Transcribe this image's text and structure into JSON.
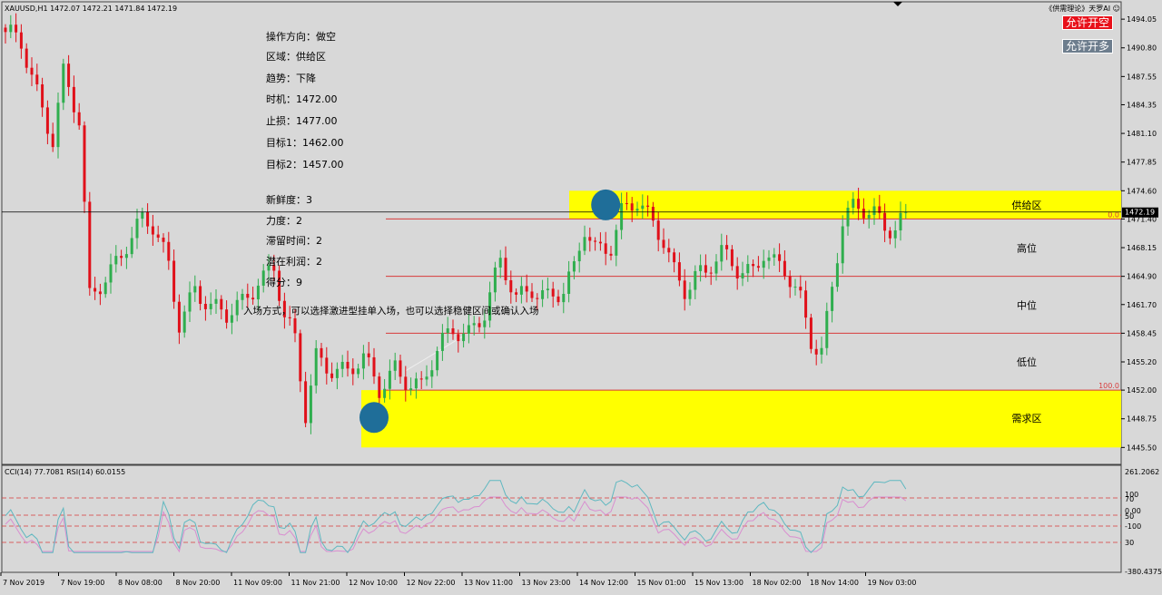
{
  "header": {
    "symbol_line": "XAUUSD,H1  1472.07 1472.21 1471.84 1472.19",
    "brand": "《供需理论》天罗AI ☺"
  },
  "buttons": {
    "sell_label": "允许开空",
    "buy_label": "允许开多"
  },
  "colors": {
    "background": "#d8d8d8",
    "bull": "#2fae4e",
    "bear": "#e0101a",
    "zone": "#ffff00",
    "level_line": "#d83a3a",
    "marker": "#1f6e99",
    "cci": "#5fb8c0",
    "rsi": "#d98ed0"
  },
  "trade_info": {
    "direction": "操作方向：做空",
    "zone": "区域：供给区",
    "trend": "趋势：下降",
    "timing": "时机：1472.00",
    "stop_loss": "止损：1477.00",
    "target1": "目标1：1462.00",
    "target2": "目标2：1457.00",
    "freshness": "新鲜度：3",
    "strength": "力度：2",
    "stay_time": "滞留时间：2",
    "profit_potential": "潜在利润：2",
    "score": "得分：9",
    "entry_note": "入场方式，可以选择激进型挂单入场，也可以选择稳健区间或确认入场"
  },
  "chart_data": [
    {
      "type": "candlestick",
      "symbol": "XAUUSD",
      "timeframe": "H1",
      "ylim": [
        1444.3,
        1495.4
      ],
      "y_ticks": [
        "1494.05",
        "1490.80",
        "1487.55",
        "1484.35",
        "1481.10",
        "1477.85",
        "1474.60",
        "1471.40",
        "1468.15",
        "1464.90",
        "1461.70",
        "1458.45",
        "1455.20",
        "1452.00",
        "1448.75",
        "1445.50"
      ],
      "current_price": "1472.19",
      "x_ticks": [
        "7 Nov 2019",
        "7 Nov 19:00",
        "8 Nov 08:00",
        "8 Nov 20:00",
        "11 Nov 09:00",
        "11 Nov 21:00",
        "12 Nov 10:00",
        "12 Nov 22:00",
        "13 Nov 11:00",
        "13 Nov 23:00",
        "14 Nov 12:00",
        "15 Nov 01:00",
        "15 Nov 13:00",
        "18 Nov 02:00",
        "18 Nov 14:00",
        "19 Nov 03:00"
      ],
      "waypoints": [
        [
          0,
          1492
        ],
        [
          3,
          1491
        ],
        [
          6,
          1486
        ],
        [
          9,
          1481
        ],
        [
          11,
          1488
        ],
        [
          14,
          1482
        ],
        [
          16,
          1462
        ],
        [
          20,
          1466
        ],
        [
          23,
          1469
        ],
        [
          26,
          1471
        ],
        [
          28,
          1470
        ],
        [
          31,
          1466
        ],
        [
          33,
          1460
        ],
        [
          36,
          1464
        ],
        [
          39,
          1461
        ],
        [
          42,
          1460
        ],
        [
          45,
          1462
        ],
        [
          48,
          1465
        ],
        [
          51,
          1466
        ],
        [
          53,
          1460
        ],
        [
          55,
          1457
        ],
        [
          57,
          1449
        ],
        [
          59,
          1456
        ],
        [
          62,
          1455
        ],
        [
          65,
          1454
        ],
        [
          68,
          1455
        ],
        [
          71,
          1452
        ],
        [
          74,
          1455
        ],
        [
          77,
          1453
        ],
        [
          79,
          1452
        ],
        [
          82,
          1456
        ],
        [
          85,
          1459
        ],
        [
          88,
          1459
        ],
        [
          91,
          1461
        ],
        [
          94,
          1466
        ],
        [
          97,
          1462
        ],
        [
          100,
          1464
        ],
        [
          103,
          1463
        ],
        [
          106,
          1463
        ],
        [
          108,
          1465
        ],
        [
          110,
          1470
        ],
        [
          112,
          1468
        ],
        [
          115,
          1469
        ],
        [
          117,
          1472.5
        ],
        [
          120,
          1473
        ],
        [
          122,
          1471
        ],
        [
          125,
          1469
        ],
        [
          127,
          1466
        ],
        [
          129,
          1464
        ],
        [
          131,
          1465
        ],
        [
          133,
          1465
        ],
        [
          136,
          1467
        ],
        [
          139,
          1466
        ],
        [
          142,
          1466
        ],
        [
          144,
          1468
        ],
        [
          146,
          1466
        ],
        [
          148,
          1465
        ],
        [
          151,
          1462
        ],
        [
          153,
          1458
        ],
        [
          155,
          1457
        ],
        [
          157,
          1464
        ],
        [
          159,
          1471
        ],
        [
          161,
          1472
        ],
        [
          163,
          1472
        ],
        [
          165,
          1472
        ],
        [
          167,
          1471
        ],
        [
          169,
          1471
        ],
        [
          171,
          1472.2
        ]
      ],
      "zones": [
        {
          "name": "供给区",
          "low": 1471.4,
          "high": 1474.6
        },
        {
          "name": "需求区",
          "low": 1445.5,
          "high": 1452.0
        }
      ],
      "levels": [
        {
          "label": "0.0",
          "value": 1471.4
        },
        {
          "label": "",
          "value": 1464.9
        },
        {
          "label": "",
          "value": 1458.45
        },
        {
          "label": "100.0",
          "value": 1452.0
        }
      ],
      "zone_labels": [
        {
          "text": "供给区",
          "value": 1473.0
        },
        {
          "text": "高位",
          "value": 1468.1
        },
        {
          "text": "中位",
          "value": 1461.6
        },
        {
          "text": "低位",
          "value": 1455.2
        },
        {
          "text": "需求区",
          "value": 1448.8
        }
      ],
      "markers": [
        {
          "bar": 114,
          "value": 1473.0
        },
        {
          "bar": 70,
          "value": 1448.9
        }
      ]
    },
    {
      "type": "line",
      "label": "CCI(14) 77.7081  RSI(14) 60.0155",
      "ylim": [
        -380.4375,
        261.2062
      ],
      "axis_labels": [
        "261.2062",
        "100",
        "70",
        "0.00",
        "50",
        "-100",
        "30",
        "-380.4375"
      ],
      "ref_lines": [
        100,
        0,
        -100
      ],
      "series": [
        {
          "name": "CCI(14)",
          "last": 77.7081
        },
        {
          "name": "RSI(14)",
          "last": 60.0155
        }
      ]
    }
  ]
}
